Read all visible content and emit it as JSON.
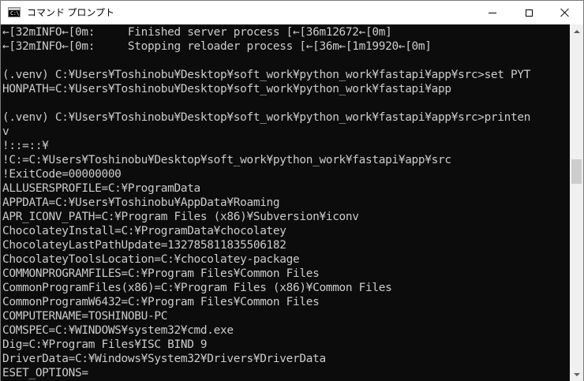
{
  "window": {
    "title": "コマンド プロンプト",
    "app_icon_text": "C:\\"
  },
  "console": {
    "lines": [
      "←[32mINFO←[0m:     Finished server process [←[36m12672←[0m]",
      "←[32mINFO←[0m:     Stopping reloader process [←[36m←[1m19920←[0m]",
      "",
      "(.venv) C:¥Users¥Toshinobu¥Desktop¥soft_work¥python_work¥fastapi¥app¥src>set PYT",
      "HONPATH=C:¥Users¥Toshinobu¥Desktop¥soft_work¥python_work¥fastapi¥app",
      "",
      "(.venv) C:¥Users¥Toshinobu¥Desktop¥soft_work¥python_work¥fastapi¥app¥src>printen",
      "v",
      "!::=::¥",
      "!C:=C:¥Users¥Toshinobu¥Desktop¥soft_work¥python_work¥fastapi¥app¥src",
      "!ExitCode=00000000",
      "ALLUSERSPROFILE=C:¥ProgramData",
      "APPDATA=C:¥Users¥Toshinobu¥AppData¥Roaming",
      "APR_ICONV_PATH=C:¥Program Files (x86)¥Subversion¥iconv",
      "ChocolateyInstall=C:¥ProgramData¥chocolatey",
      "ChocolateyLastPathUpdate=132785811835506182",
      "ChocolateyToolsLocation=C:¥chocolatey-package",
      "COMMONPROGRAMFILES=C:¥Program Files¥Common Files",
      "CommonProgramFiles(x86)=C:¥Program Files (x86)¥Common Files",
      "CommonProgramW6432=C:¥Program Files¥Common Files",
      "COMPUTERNAME=TOSHINOBU-PC",
      "COMSPEC=C:¥WINDOWS¥system32¥cmd.exe",
      "Dig=C:¥Program Files¥ISC BIND 9",
      "DriverData=C:¥Windows¥System32¥Drivers¥DriverData",
      "ESET_OPTIONS="
    ]
  },
  "colors": {
    "console_bg": "#0c0c0c",
    "console_text": "#cccccc",
    "titlebar_bg": "#ffffff",
    "scrollbar_bg": "#f0f0f0",
    "scrollbar_thumb": "#cdcdcd"
  },
  "icons": {
    "app": "cmd-prompt-icon",
    "minimize": "minimize-icon",
    "maximize": "maximize-icon",
    "close": "close-icon"
  }
}
